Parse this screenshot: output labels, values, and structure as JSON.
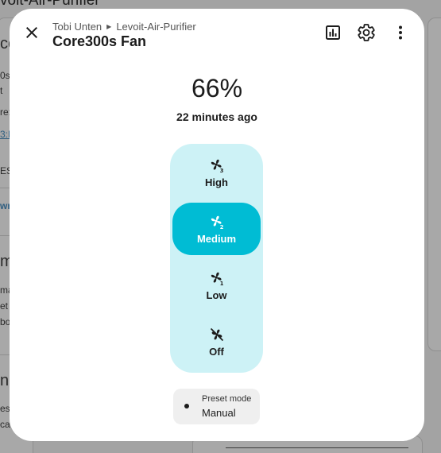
{
  "background": {
    "title": "voit-Air-Purifier",
    "fragments": [
      "ce",
      "0s",
      "t",
      "re:",
      "3:E",
      "ES",
      "wn",
      "m",
      "ma",
      "et",
      "bo",
      "ne",
      "es",
      "ca"
    ]
  },
  "dialog": {
    "breadcrumb": {
      "parent": "Tobi Unten",
      "child": "Levoit-Air-Purifier"
    },
    "title": "Core300s Fan",
    "toolbar": {
      "close_icon": "close-icon",
      "history_icon": "chart-box-icon",
      "settings_icon": "gear-icon",
      "menu_icon": "dots-vertical-icon"
    },
    "state": {
      "value": "66%",
      "last_changed": "22 minutes ago"
    },
    "speed_options": [
      {
        "label": "High",
        "icon": "fan-speed-3-icon",
        "active": false
      },
      {
        "label": "Medium",
        "icon": "fan-speed-2-icon",
        "active": true
      },
      {
        "label": "Low",
        "icon": "fan-speed-1-icon",
        "active": false
      },
      {
        "label": "Off",
        "icon": "fan-off-icon",
        "active": false
      }
    ],
    "preset": {
      "name": "Preset mode",
      "value": "Manual"
    }
  },
  "colors": {
    "accent": "#00bcd4",
    "control_track": "#cdf2f6",
    "chip_bg": "#efefef"
  }
}
